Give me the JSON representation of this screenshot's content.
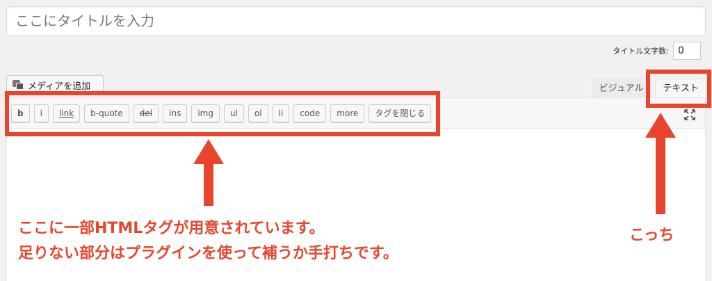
{
  "title": {
    "placeholder": "ここにタイトルを入力"
  },
  "title_count": {
    "label": "タイトル文字数:",
    "value": "0"
  },
  "media_button": {
    "label": "メディアを追加"
  },
  "tabs": {
    "visual": "ビジュアル",
    "text": "テキスト"
  },
  "quicktags": [
    "b",
    "i",
    "link",
    "b-quote",
    "del",
    "ins",
    "img",
    "ul",
    "ol",
    "li",
    "code",
    "more",
    "タグを閉じる"
  ],
  "annotations": {
    "line1": "ここに一部HTMLタグが用意されています。",
    "line2": "足りない部分はプラグインを使って補うか手打ちです。",
    "tab_note": "こっち"
  },
  "colors": {
    "annotation": "#e8452c",
    "background": "#f1f1f1"
  }
}
